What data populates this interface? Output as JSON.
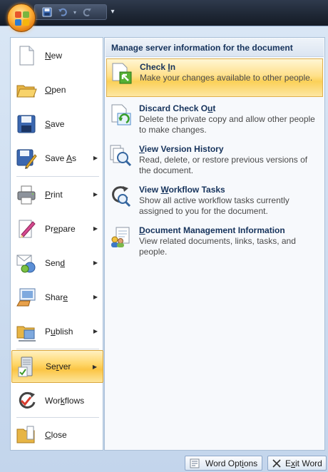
{
  "quick_access": {
    "items": [
      "save-icon",
      "undo-icon",
      "undo-dropdown-icon",
      "redo-icon"
    ],
    "more": "▾"
  },
  "office_button": {
    "icon": "office-logo-icon"
  },
  "left_menu": {
    "items": [
      {
        "label_pre": "",
        "label_u": "N",
        "label_post": "ew",
        "icon": "new-document-icon",
        "has_arrow": false
      },
      {
        "label_pre": "",
        "label_u": "O",
        "label_post": "pen",
        "icon": "open-folder-icon",
        "has_arrow": false
      },
      {
        "label_pre": "",
        "label_u": "S",
        "label_post": "ave",
        "icon": "save-icon",
        "has_arrow": false
      },
      {
        "label_pre": "Save ",
        "label_u": "A",
        "label_post": "s",
        "icon": "save-as-icon",
        "has_arrow": true
      },
      {
        "label_pre": "",
        "label_u": "P",
        "label_post": "rint",
        "icon": "print-icon",
        "has_arrow": true
      },
      {
        "label_pre": "Pr",
        "label_u": "e",
        "label_post": "pare",
        "icon": "prepare-icon",
        "has_arrow": true
      },
      {
        "label_pre": "Sen",
        "label_u": "d",
        "label_post": "",
        "icon": "send-icon",
        "has_arrow": true
      },
      {
        "label_pre": "Shar",
        "label_u": "e",
        "label_post": "",
        "icon": "share-icon",
        "has_arrow": true
      },
      {
        "label_pre": "P",
        "label_u": "u",
        "label_post": "blish",
        "icon": "publish-icon",
        "has_arrow": true
      },
      {
        "label_pre": "Se",
        "label_u": "r",
        "label_post": "ver",
        "icon": "server-icon",
        "has_arrow": true
      },
      {
        "label_pre": "Wor",
        "label_u": "k",
        "label_post": "flows",
        "icon": "workflows-icon",
        "has_arrow": false
      },
      {
        "label_pre": "",
        "label_u": "C",
        "label_post": "lose",
        "icon": "close-folder-icon",
        "has_arrow": false
      }
    ],
    "selected": "Server",
    "arrow": "▶"
  },
  "right_pane": {
    "header": "Manage server information for the document",
    "items": [
      {
        "title_pre": "Check ",
        "title_u": "I",
        "title_post": "n",
        "desc": "Make your changes available to other people.",
        "icon": "check-in-icon"
      },
      {
        "title_pre": "Discard Check O",
        "title_u": "u",
        "title_post": "t",
        "desc": "Delete the private copy and allow other people to make changes.",
        "icon": "discard-check-out-icon"
      },
      {
        "title_pre": "",
        "title_u": "V",
        "title_post": "iew Version History",
        "desc": "Read, delete, or restore previous versions of the document.",
        "icon": "version-history-icon"
      },
      {
        "title_pre": "View ",
        "title_u": "W",
        "title_post": "orkflow Tasks",
        "desc": "Show all active workflow tasks currently assigned to you for the document.",
        "icon": "workflow-tasks-icon"
      },
      {
        "title_pre": "",
        "title_u": "D",
        "title_post": "ocument Management Information",
        "desc": "View related documents, links, tasks, and people.",
        "icon": "document-management-icon"
      }
    ],
    "hot_item": "Check In"
  },
  "footer": {
    "options_pre": "Word Opt",
    "options_u": "i",
    "options_post": "ons",
    "exit_pre": "E",
    "exit_u": "x",
    "exit_post": "it Word"
  }
}
